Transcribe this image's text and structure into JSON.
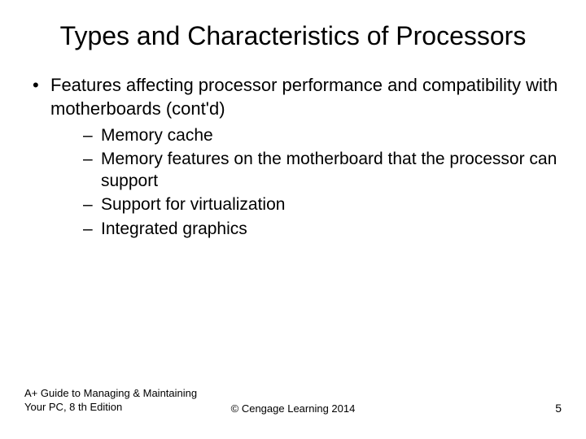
{
  "title": "Types and Characteristics of Processors",
  "bullet": "Features affecting processor performance and compatibility with motherboards (cont'd)",
  "sub": {
    "0": "Memory cache",
    "1": "Memory features on the motherboard that the processor can support",
    "2": "Support for virtualization",
    "3": "Integrated graphics"
  },
  "footer": {
    "left": "A+ Guide to Managing & Maintaining Your PC, 8 th Edition",
    "center": "© Cengage Learning  2014",
    "right": "5"
  }
}
